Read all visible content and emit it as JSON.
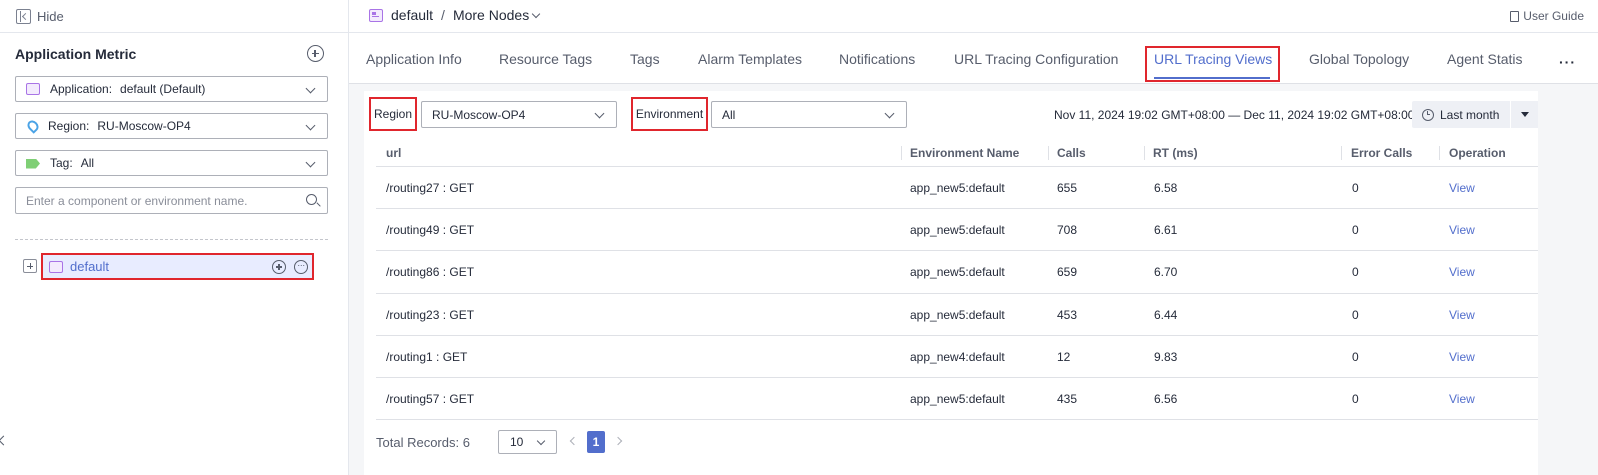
{
  "topbar": {
    "hide_label": "Hide",
    "breadcrumb": {
      "root": "default",
      "separator": "/",
      "current": "More Nodes"
    },
    "user_guide": "User Guide"
  },
  "sidebar": {
    "title": "Application Metric",
    "application": {
      "label": "Application:",
      "value": "default (Default)"
    },
    "region": {
      "label": "Region:",
      "value": "RU-Moscow-OP4"
    },
    "tag": {
      "label": "Tag:",
      "value": "All"
    },
    "search_placeholder": "Enter a component or environment name.",
    "tree": [
      {
        "name": "default"
      }
    ]
  },
  "tabs": [
    {
      "label": "Application Info"
    },
    {
      "label": "Resource Tags"
    },
    {
      "label": "Tags"
    },
    {
      "label": "Alarm Templates"
    },
    {
      "label": "Notifications"
    },
    {
      "label": "URL Tracing Configuration"
    },
    {
      "label": "URL Tracing Views",
      "active": true
    },
    {
      "label": "Global Topology"
    },
    {
      "label": "Agent Statis"
    }
  ],
  "tab_more": "···",
  "filters": {
    "region_label": "Region",
    "region_value": "RU-Moscow-OP4",
    "environment_label": "Environment",
    "environment_value": "All",
    "date_range": "Nov 11, 2024 19:02 GMT+08:00 — Dec 11, 2024 19:02 GMT+08:00",
    "period": "Last month"
  },
  "table": {
    "headers": [
      "url",
      "Environment Name",
      "Calls",
      "RT (ms)",
      "Error Calls",
      "Operation"
    ],
    "rows": [
      {
        "url": "/routing27 : GET",
        "env": "app_new5:default",
        "calls": "655",
        "rt": "6.58",
        "errors": "0",
        "op": "View"
      },
      {
        "url": "/routing49 : GET",
        "env": "app_new5:default",
        "calls": "708",
        "rt": "6.61",
        "errors": "0",
        "op": "View"
      },
      {
        "url": "/routing86 : GET",
        "env": "app_new5:default",
        "calls": "659",
        "rt": "6.70",
        "errors": "0",
        "op": "View"
      },
      {
        "url": "/routing23 : GET",
        "env": "app_new5:default",
        "calls": "453",
        "rt": "6.44",
        "errors": "0",
        "op": "View"
      },
      {
        "url": "/routing1 : GET",
        "env": "app_new4:default",
        "calls": "12",
        "rt": "9.83",
        "errors": "0",
        "op": "View"
      },
      {
        "url": "/routing57 : GET",
        "env": "app_new5:default",
        "calls": "435",
        "rt": "6.56",
        "errors": "0",
        "op": "View"
      }
    ]
  },
  "pagination": {
    "total": "Total Records: 6",
    "page_size": "10",
    "current_page": "1"
  },
  "colors": {
    "accent": "#526ecc",
    "highlight_border": "#e0262d",
    "node_icon": "#a974e6"
  }
}
